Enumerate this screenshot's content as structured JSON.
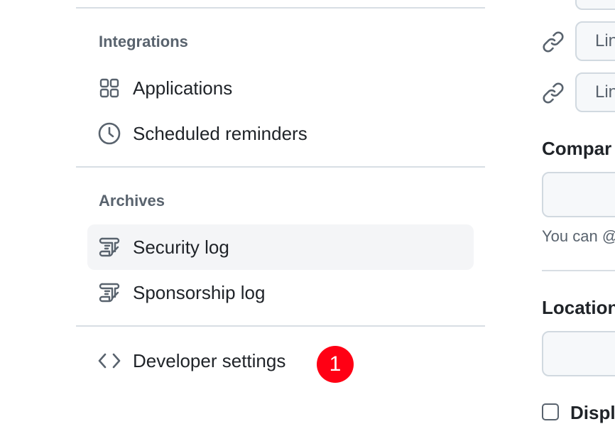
{
  "sidebar": {
    "integrations": {
      "title": "Integrations",
      "items": [
        {
          "label": "Applications",
          "icon": "apps-grid-icon"
        },
        {
          "label": "Scheduled reminders",
          "icon": "clock-icon"
        }
      ]
    },
    "archives": {
      "title": "Archives",
      "items": [
        {
          "label": "Security log",
          "icon": "log-icon",
          "selected": true
        },
        {
          "label": "Sponsorship log",
          "icon": "log-icon"
        }
      ]
    },
    "developer": {
      "label": "Developer settings",
      "icon": "code-icon",
      "badge": "1"
    }
  },
  "profile": {
    "social_links": [
      {
        "placeholder": "Lin"
      },
      {
        "placeholder": "Lin"
      }
    ],
    "company": {
      "label": "Compar",
      "hint": "You can @"
    },
    "location": {
      "label": "Location"
    },
    "display_checkbox": {
      "label": "Displ"
    }
  },
  "colors": {
    "badge": "#ff0014",
    "selected_bg": "#f4f5f7",
    "muted_text": "#59636e",
    "border": "#d1d9e0"
  }
}
